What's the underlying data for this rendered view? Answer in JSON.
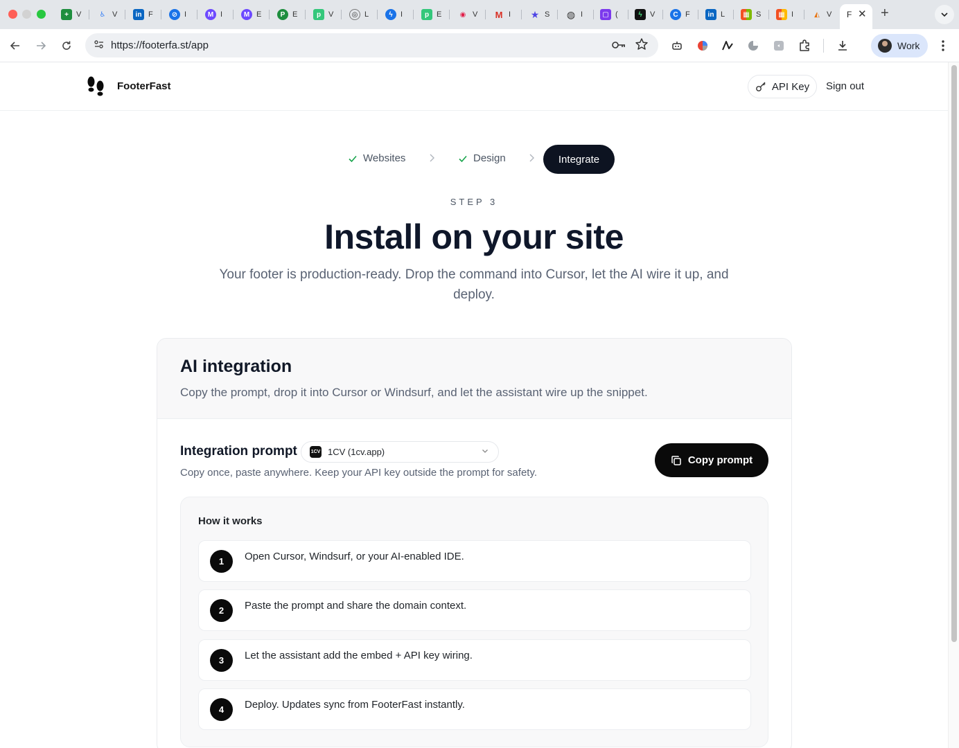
{
  "browser": {
    "tabs": [
      {
        "label": "V",
        "color": "#1e8e3e",
        "glyph": "+"
      },
      {
        "label": "V",
        "color": "#3b82f6",
        "glyph": "♿"
      },
      {
        "label": "F",
        "color": "#0a66c2",
        "glyph": "in"
      },
      {
        "label": "I",
        "color": "#1a73e8",
        "glyph": "⊘"
      },
      {
        "label": "I",
        "color": "#6d4aff",
        "glyph": "M"
      },
      {
        "label": "E",
        "color": "#6d4aff",
        "glyph": "M"
      },
      {
        "label": "E",
        "color": "#1e8e3e",
        "glyph": "P"
      },
      {
        "label": "V",
        "color": "#34c77b",
        "glyph": "p"
      },
      {
        "label": "L",
        "color": "#ffffff",
        "glyph": "◎"
      },
      {
        "label": "I",
        "color": "#1a73e8",
        "glyph": "ϟ"
      },
      {
        "label": "E",
        "color": "#34c77b",
        "glyph": "p"
      },
      {
        "label": "V",
        "color": "#ffe4e6",
        "glyph": "◉"
      },
      {
        "label": "I",
        "color": "#ffffff",
        "glyph": "M"
      },
      {
        "label": "S",
        "color": "#ffffff",
        "glyph": "★"
      },
      {
        "label": "I",
        "color": "#ffffff",
        "glyph": "◍"
      },
      {
        "label": "(",
        "color": "#7c3aed",
        "glyph": "▢"
      },
      {
        "label": "V",
        "color": "#111111",
        "glyph": "ϟ"
      },
      {
        "label": "F",
        "color": "#1a73e8",
        "glyph": "C"
      },
      {
        "label": "L",
        "color": "#0a66c2",
        "glyph": "in"
      },
      {
        "label": "S",
        "color": "#ffffff",
        "glyph": "▦"
      },
      {
        "label": "I",
        "color": "#ffffff",
        "glyph": "▦"
      },
      {
        "label": "V",
        "color": "#ffffff",
        "glyph": "◭"
      }
    ],
    "active_tab_label": "F",
    "url": "https://footerfa.st/app",
    "profile_name": "Work"
  },
  "header": {
    "brand": "FooterFast",
    "api_key_label": "API Key",
    "sign_out_label": "Sign out"
  },
  "stepper": {
    "steps": [
      {
        "label": "Websites",
        "state": "done"
      },
      {
        "label": "Design",
        "state": "done"
      },
      {
        "label": "Integrate",
        "state": "active"
      }
    ]
  },
  "hero": {
    "eyebrow": "STEP 3",
    "title": "Install on your site",
    "subtitle": "Your footer is production-ready. Drop the command into Cursor, let the AI wire it up, and deploy."
  },
  "card": {
    "title": "AI integration",
    "description": "Copy the prompt, drop it into Cursor or Windsurf, and let the assistant wire up the snippet.",
    "prompt_title": "Integration prompt",
    "site_badge": "1CV",
    "site_select_value": "1CV (1cv.app)",
    "prompt_hint": "Copy once, paste anywhere. Keep your API key outside the prompt for safety.",
    "copy_button_label": "Copy prompt",
    "how": {
      "title": "How it works",
      "steps": [
        {
          "num": "1",
          "text": "Open Cursor, Windsurf, or your AI-enabled IDE."
        },
        {
          "num": "2",
          "text": "Paste the prompt and share the domain context."
        },
        {
          "num": "3",
          "text": "Let the assistant add the embed + API key wiring."
        },
        {
          "num": "4",
          "text": "Deploy. Updates sync from FooterFast instantly."
        }
      ]
    }
  },
  "colors": {
    "accent_dark": "#0d1321",
    "check_green": "#16a34a",
    "muted_text": "#596273"
  }
}
